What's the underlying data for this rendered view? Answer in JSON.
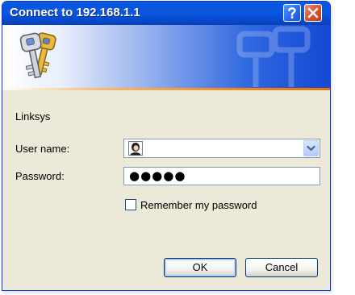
{
  "window": {
    "title": "Connect to 192.168.1.1",
    "help_icon": "question-mark-icon",
    "close_icon": "close-x-icon"
  },
  "banner": {
    "icon": "keys-icon",
    "accent_colors": [
      "#0a5fe6",
      "#f08a1e"
    ]
  },
  "realm_text": "Linksys",
  "form": {
    "username_label": "User name:",
    "username_value": "",
    "username_icon": "user-avatar-icon",
    "password_label": "Password:",
    "password_value": "●●●●●",
    "remember_label": "Remember my password",
    "remember_checked": false
  },
  "buttons": {
    "ok": "OK",
    "cancel": "Cancel"
  }
}
